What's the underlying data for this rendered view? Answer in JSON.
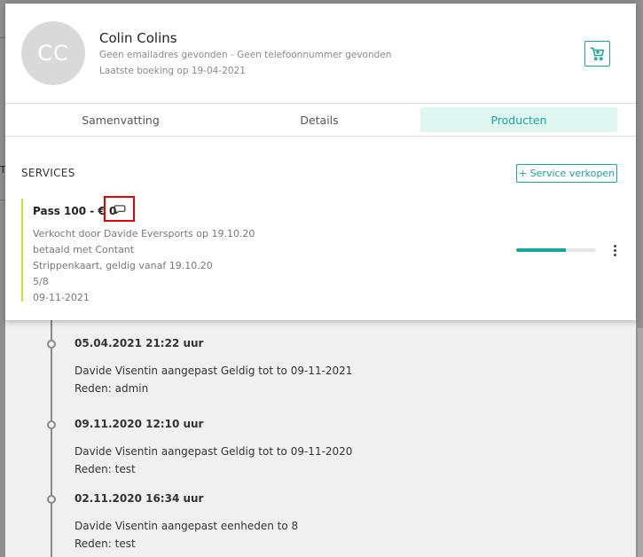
{
  "background": {
    "left_mark": "T"
  },
  "customer": {
    "initials": "CC",
    "name": "Colin Colins",
    "contact_info": "Geen emailadres gevonden - Geen telefoonnummer gevonden",
    "last_booking": "Laatste boeking op 19-04-2021"
  },
  "tabs": [
    {
      "label": "Samenvatting",
      "active": false
    },
    {
      "label": "Details",
      "active": false
    },
    {
      "label": "Producten",
      "active": true
    }
  ],
  "services": {
    "title": "SERVICES",
    "sell_button": "+ Service verkopen",
    "items": [
      {
        "title": "Pass 100 - € 0",
        "lines": [
          "Verkocht door Davide Eversports op 19.10.20",
          "betaald met Contant",
          "Strippenkaart, geldig vanaf 19.10.20",
          "5/8",
          "09-11-2021"
        ],
        "progress": 0.625
      }
    ]
  },
  "history": [
    {
      "date": "05.04.2021 21:22 uur",
      "text": "Davide Visentin aangepast Geldig tot to 09-11-2021",
      "reason": "Reden: admin"
    },
    {
      "date": "09.11.2020 12:10 uur",
      "text": "Davide Visentin aangepast Geldig tot to 09-11-2020",
      "reason": "Reden: test"
    },
    {
      "date": "02.11.2020 16:34 uur",
      "text": "Davide Visentin aangepast eenheden to 8",
      "reason": "Reden: test"
    }
  ],
  "colors": {
    "accent": "#1aa59a",
    "active_tab_bg": "#dff5ef",
    "card_border": "#c6e33a",
    "highlight": "#e00000"
  },
  "icons": {
    "cart": "shopping-cart-icon",
    "comment": "comment-icon",
    "more": "more-vertical-icon"
  }
}
